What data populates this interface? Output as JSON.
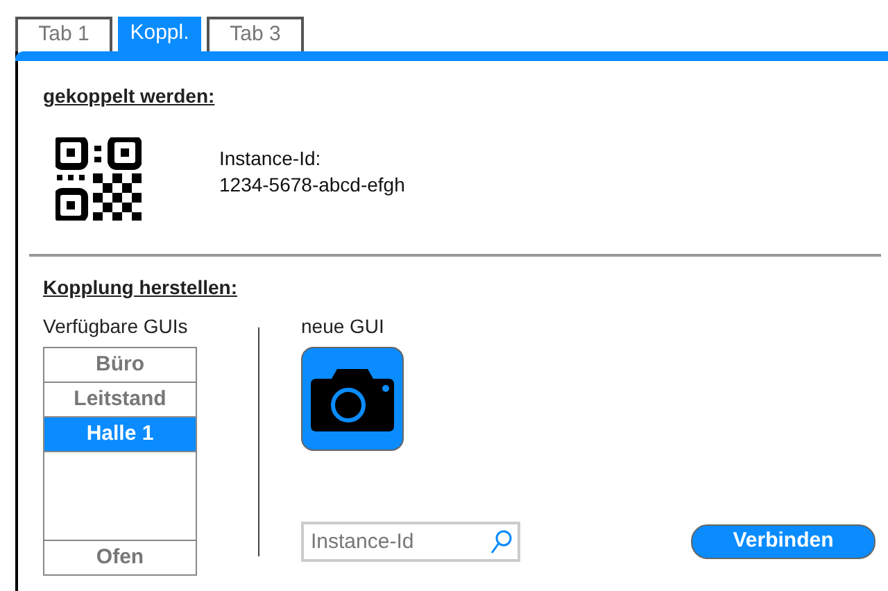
{
  "tabs": [
    {
      "label": "Tab 1",
      "selected": false
    },
    {
      "label": "Koppl.",
      "selected": true
    },
    {
      "label": "Tab 3",
      "selected": false
    }
  ],
  "coupled": {
    "heading": "gekoppelt werden:",
    "id_label": "Instance-Id:",
    "id_value": "1234-5678-abcd-efgh"
  },
  "pairing": {
    "heading": "Kopplung herstellen:",
    "list_label": "Verfügbare GUIs",
    "items": [
      {
        "label": "Büro",
        "selected": false
      },
      {
        "label": "Leitstand",
        "selected": false
      },
      {
        "label": "Halle 1",
        "selected": true
      },
      {
        "label": "Ofen",
        "selected": false
      }
    ],
    "new_label": "neue GUI",
    "search": {
      "placeholder": "Instance-Id"
    },
    "button": "Verbinden"
  }
}
